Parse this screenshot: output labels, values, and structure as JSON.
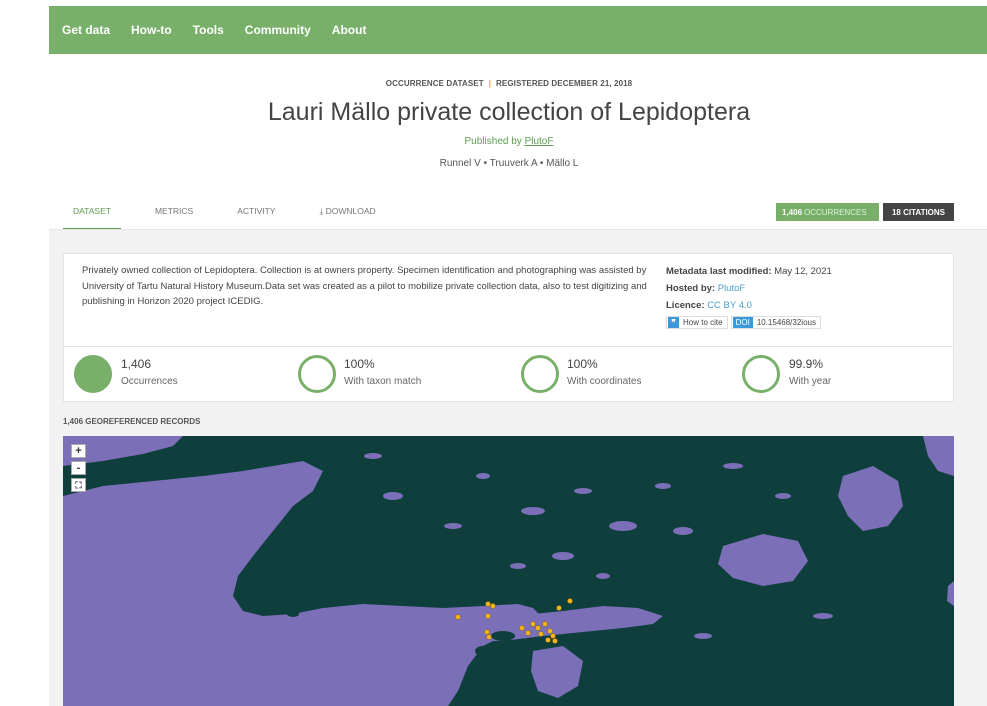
{
  "nav": [
    "Get data",
    "How-to",
    "Tools",
    "Community",
    "About"
  ],
  "header": {
    "type_label": "OCCURRENCE DATASET",
    "registered": "REGISTERED DECEMBER 21, 2018",
    "title": "Lauri Mällo private collection of Lepidoptera",
    "published_prefix": "Published by",
    "publisher": "PlutoF",
    "authors": "Runnel V • Truuverk A • Mällo L"
  },
  "tabs": [
    "DATASET",
    "METRICS",
    "ACTIVITY",
    "⤓ DOWNLOAD"
  ],
  "pills": {
    "occ_count": "1,406",
    "occ_label": "OCCURRENCES",
    "citations": "18 CITATIONS"
  },
  "description": "Privately owned collection of Lepidoptera. Collection is at owners property. Specimen identification and photographing was assisted by University of Tartu Natural History Museum.Data set was created as a pilot to mobilize private collection data, also to test digitizing and publishing in Horizon 2020 project ICEDIG.",
  "side": {
    "modified_label": "Metadata last modified:",
    "modified_value": "May 12, 2021",
    "hosted_label": "Hosted by:",
    "hosted_value": "PlutoF",
    "licence_label": "Licence:",
    "licence_value": "CC BY 4.0",
    "cite_label": "How to cite",
    "doi_label": "DOI",
    "doi_value": "10.15468/32ious"
  },
  "stats": [
    {
      "value": "1,406",
      "label": "Occurrences"
    },
    {
      "value": "100%",
      "label": "With taxon match"
    },
    {
      "value": "100%",
      "label": "With coordinates"
    },
    {
      "value": "99.9%",
      "label": "With year"
    }
  ],
  "map": {
    "heading": "1,406 GEOREFERENCED RECORDS",
    "zoom_in": "+",
    "zoom_out": "-",
    "fullscreen": "⛶",
    "land_color": "#0f3f3c",
    "water_color": "#7b6fb8",
    "point_color": "#f2b51e"
  },
  "colors": {
    "accent": "#78b06a",
    "link": "#4a9fc8",
    "dark_pill": "#444444"
  }
}
